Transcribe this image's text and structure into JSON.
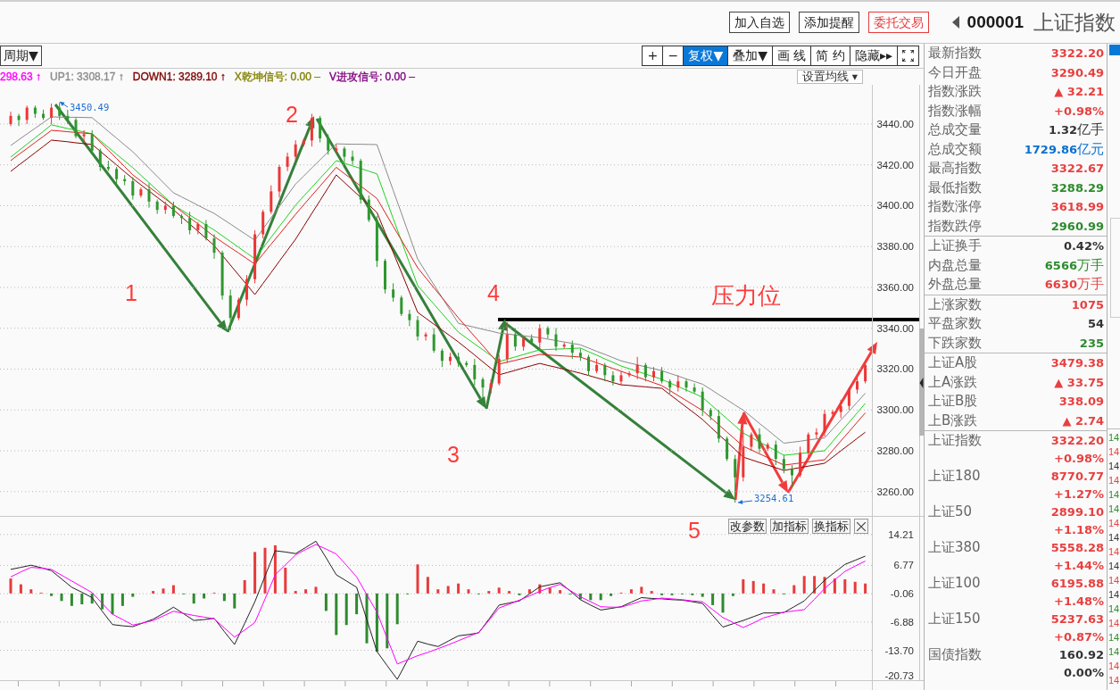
{
  "top_bar": {
    "buttons": [
      {
        "label": "加入自选",
        "kind": "plain"
      },
      {
        "label": "添加提醒",
        "kind": "plain"
      },
      {
        "label": "委托交易",
        "kind": "trade"
      }
    ],
    "code": "000001",
    "name": "上证指数"
  },
  "chart_toolbar": {
    "period_button": "周期▼",
    "buttons": [
      {
        "label": "+",
        "kind": "text",
        "selected": false
      },
      {
        "label": "−",
        "kind": "text",
        "selected": false
      },
      {
        "label": "复权▼",
        "kind": "text",
        "selected": true
      },
      {
        "label": "叠加▼",
        "kind": "text",
        "selected": false
      },
      {
        "label": "画 线",
        "kind": "text",
        "selected": false
      },
      {
        "label": "简 约",
        "kind": "text",
        "selected": false
      },
      {
        "label": "隐藏▸▸",
        "kind": "text",
        "selected": false
      },
      {
        "kind": "fullscreen",
        "selected": false
      }
    ]
  },
  "legend": [
    {
      "text": "298.63 ↑",
      "color": "#ff00ff"
    },
    {
      "text": "UP1: 3308.17 ↑",
      "color": "#8c8c8c"
    },
    {
      "text": "DOWN1: 3289.10 ↑",
      "color": "#800000"
    },
    {
      "text": "X乾坤信号: 0.00 –",
      "color": "#808000"
    },
    {
      "text": "V进攻信号: 0.00 –",
      "color": "#800080"
    }
  ],
  "ma_dropdown": "设置均线 ▾",
  "price_chart": {
    "high_label": "3450.49",
    "low_label": "3254.61",
    "chart_data": {
      "type": "candlestick",
      "grid": true,
      "ylim": [
        3248.1,
        3459.2
      ],
      "yticks": [
        {
          "value": 3440,
          "label": "3440.00"
        },
        {
          "value": 3420,
          "label": "3420.00"
        },
        {
          "value": 3400,
          "label": "3400.00"
        },
        {
          "value": 3380,
          "label": "3380.00"
        },
        {
          "value": 3360,
          "label": "3360.00"
        },
        {
          "value": 3340,
          "label": "3340.00"
        },
        {
          "value": 3320,
          "label": "3320.00"
        },
        {
          "value": 3300,
          "label": "3300.00"
        },
        {
          "value": 3280,
          "label": "3280.00"
        },
        {
          "value": 3260,
          "label": "3260.00"
        }
      ],
      "ohlc": [
        [
          3440,
          3446,
          3439,
          3444
        ],
        [
          3444,
          3445,
          3439,
          3442
        ],
        [
          3442,
          3449,
          3440,
          3448
        ],
        [
          3448,
          3449,
          3443,
          3445
        ],
        [
          3445,
          3447,
          3442,
          3443
        ],
        [
          3443,
          3450,
          3440,
          3448
        ],
        [
          3448,
          3450.5,
          3442,
          3444
        ],
        [
          3444,
          3447,
          3440,
          3442
        ],
        [
          3442,
          3443,
          3433,
          3434
        ],
        [
          3434,
          3437,
          3431,
          3435
        ],
        [
          3435,
          3437,
          3425,
          3427
        ],
        [
          3427,
          3428,
          3417,
          3419
        ],
        [
          3419,
          3422,
          3417,
          3418
        ],
        [
          3418,
          3419,
          3410,
          3413
        ],
        [
          3413,
          3415,
          3410,
          3412
        ],
        [
          3412,
          3414,
          3403,
          3405
        ],
        [
          3405,
          3409,
          3404,
          3408
        ],
        [
          3408,
          3411,
          3399,
          3402
        ],
        [
          3402,
          3403,
          3396,
          3398
        ],
        [
          3398,
          3402,
          3396,
          3400
        ],
        [
          3400,
          3402,
          3394,
          3395
        ],
        [
          3395,
          3396,
          3391,
          3394
        ],
        [
          3394,
          3397,
          3386,
          3388
        ],
        [
          3388,
          3392,
          3386,
          3391
        ],
        [
          3391,
          3393,
          3383,
          3384
        ],
        [
          3384,
          3386,
          3374,
          3377
        ],
        [
          3377,
          3378,
          3354,
          3356
        ],
        [
          3356,
          3359,
          3339,
          3345
        ],
        [
          3345,
          3355,
          3344,
          3354
        ],
        [
          3354,
          3366,
          3351,
          3364
        ],
        [
          3364,
          3388,
          3362,
          3386
        ],
        [
          3386,
          3398,
          3384,
          3397
        ],
        [
          3397,
          3410,
          3396,
          3407
        ],
        [
          3407,
          3420,
          3404,
          3419
        ],
        [
          3419,
          3426,
          3417,
          3424
        ],
        [
          3424,
          3432,
          3422,
          3430
        ],
        [
          3430,
          3433,
          3429,
          3432
        ],
        [
          3432,
          3445,
          3429,
          3443
        ],
        [
          3443,
          3444,
          3431,
          3433
        ],
        [
          3433,
          3435,
          3425,
          3427
        ],
        [
          3427,
          3430,
          3426,
          3428
        ],
        [
          3428,
          3429,
          3421,
          3424
        ],
        [
          3424,
          3427,
          3420,
          3422
        ],
        [
          3422,
          3423,
          3401,
          3403
        ],
        [
          3403,
          3405,
          3392,
          3393
        ],
        [
          3393,
          3395,
          3370,
          3373
        ],
        [
          3373,
          3374,
          3357,
          3359
        ],
        [
          3359,
          3362,
          3353,
          3355
        ],
        [
          3355,
          3356,
          3346,
          3347
        ],
        [
          3347,
          3349,
          3341,
          3344
        ],
        [
          3344,
          3346,
          3334,
          3336
        ],
        [
          3336,
          3338,
          3334,
          3337
        ],
        [
          3337,
          3340,
          3328,
          3329
        ],
        [
          3329,
          3330,
          3321,
          3324
        ],
        [
          3324,
          3328,
          3322,
          3326
        ],
        [
          3326,
          3328,
          3321,
          3323
        ],
        [
          3323,
          3324,
          3321,
          3322
        ],
        [
          3322,
          3325,
          3312,
          3315
        ],
        [
          3315,
          3316,
          3302,
          3311
        ],
        [
          3311,
          3315,
          3308,
          3313
        ],
        [
          3313,
          3327,
          3312,
          3325
        ],
        [
          3325,
          3343,
          3323,
          3337
        ],
        [
          3337,
          3340,
          3329,
          3331
        ],
        [
          3331,
          3336,
          3329,
          3335
        ],
        [
          3335,
          3337,
          3332,
          3333
        ],
        [
          3333,
          3342,
          3330,
          3340
        ],
        [
          3340,
          3341,
          3335,
          3337
        ],
        [
          3337,
          3340,
          3329,
          3331
        ],
        [
          3331,
          3333,
          3330,
          3332
        ],
        [
          3332,
          3334,
          3325,
          3328
        ],
        [
          3328,
          3330,
          3324,
          3326
        ],
        [
          3326,
          3327,
          3317,
          3319
        ],
        [
          3319,
          3325,
          3318,
          3322
        ],
        [
          3322,
          3323,
          3314,
          3317
        ],
        [
          3317,
          3319,
          3312,
          3314
        ],
        [
          3314,
          3319,
          3312,
          3317
        ],
        [
          3317,
          3319,
          3316,
          3318
        ],
        [
          3318,
          3326,
          3315,
          3322
        ],
        [
          3322,
          3323,
          3314,
          3316
        ],
        [
          3316,
          3321,
          3314,
          3319
        ],
        [
          3319,
          3321,
          3313,
          3314
        ],
        [
          3314,
          3315,
          3308,
          3311
        ],
        [
          3311,
          3317,
          3309,
          3314
        ],
        [
          3314,
          3315,
          3309,
          3311
        ],
        [
          3311,
          3313,
          3308,
          3309
        ],
        [
          3309,
          3311,
          3297,
          3300
        ],
        [
          3300,
          3301,
          3295,
          3297
        ],
        [
          3297,
          3300,
          3284,
          3286
        ],
        [
          3286,
          3287,
          3275,
          3276
        ],
        [
          3276,
          3278,
          3254.6,
          3267
        ],
        [
          3267,
          3290,
          3265,
          3282
        ],
        [
          3282,
          3289,
          3280,
          3288
        ],
        [
          3288,
          3291,
          3279,
          3281
        ],
        [
          3281,
          3284,
          3280,
          3283
        ],
        [
          3283,
          3285,
          3273,
          3276
        ],
        [
          3276,
          3278,
          3269,
          3271
        ],
        [
          3271,
          3273,
          3262,
          3268
        ],
        [
          3268,
          3282,
          3267,
          3279
        ],
        [
          3279,
          3289,
          3276,
          3288
        ],
        [
          3288,
          3291,
          3286,
          3289
        ],
        [
          3289,
          3300,
          3287,
          3298
        ],
        [
          3298,
          3300,
          3297,
          3299
        ],
        [
          3299,
          3305,
          3296,
          3302
        ],
        [
          3302,
          3311,
          3300,
          3310
        ],
        [
          3310,
          3316,
          3308,
          3314
        ],
        [
          3314,
          3323,
          3313,
          3322
        ]
      ],
      "series": [
        {
          "type": "line",
          "color": "#8a8a8a",
          "values": [
            3429.5,
            3432.3,
            3435.1,
            3437.9,
            3440.7,
            3443.5,
            3443.4,
            3443.3,
            3443.3,
            3443.2,
            3443.1,
            3439.8,
            3436.4,
            3433.1,
            3429.7,
            3426.4,
            3422.4,
            3418.4,
            3414.3,
            3410.3,
            3406.3,
            3404.3,
            3402.3,
            3400.2,
            3398.2,
            3396.2,
            3393.6,
            3391.0,
            3388.3,
            3385.7,
            3383.1,
            3388.6,
            3394.1,
            3399.6,
            3405.1,
            3410.6,
            3414.5,
            3418.5,
            3422.4,
            3426.4,
            3430.3,
            3430.2,
            3430.1,
            3430.1,
            3430.0,
            3429.9,
            3418.7,
            3407.5,
            3396.3,
            3385.1,
            3373.9,
            3367.6,
            3361.3,
            3355.0,
            3348.7,
            3342.4,
            3341.4,
            3340.5,
            3339.5,
            3338.6,
            3337.6,
            3337.2,
            3336.7,
            3336.3,
            3335.8,
            3335.4,
            3334.7,
            3334.0,
            3333.3,
            3332.6,
            3331.9,
            3330.3,
            3328.7,
            3327.2,
            3325.6,
            3324.0,
            3323.0,
            3322.1,
            3321.1,
            3320.2,
            3319.2,
            3317.9,
            3316.6,
            3315.2,
            3313.9,
            3312.6,
            3310.1,
            3307.5,
            3305.0,
            3302.4,
            3299.9,
            3296.7,
            3293.4,
            3290.2,
            3286.9,
            3283.7,
            3284.2,
            3284.7,
            3285.3,
            3285.8,
            3286.3,
            3290.7,
            3295.1,
            3299.4,
            3303.8,
            3308.2
          ]
        },
        {
          "type": "line",
          "color": "#1ed21e",
          "values": [
            3423.8,
            3427.0,
            3430.1,
            3433.3,
            3436.4,
            3439.6,
            3438.7,
            3437.8,
            3437.0,
            3436.1,
            3435.2,
            3431.9,
            3428.6,
            3425.2,
            3421.9,
            3418.6,
            3414.9,
            3411.3,
            3407.6,
            3404.0,
            3400.3,
            3397.9,
            3395.4,
            3393.0,
            3390.5,
            3388.1,
            3385.3,
            3382.5,
            3379.6,
            3376.8,
            3374.0,
            3379.3,
            3384.5,
            3389.8,
            3395.0,
            3400.3,
            3404.7,
            3409.0,
            3413.4,
            3417.7,
            3422.1,
            3420.8,
            3419.5,
            3418.2,
            3416.9,
            3415.6,
            3404.7,
            3393.7,
            3382.8,
            3371.8,
            3360.9,
            3356.3,
            3351.8,
            3347.2,
            3342.7,
            3338.1,
            3335.2,
            3332.3,
            3329.5,
            3326.6,
            3323.7,
            3324.8,
            3326.0,
            3327.1,
            3328.3,
            3329.4,
            3329.6,
            3329.8,
            3329.9,
            3330.1,
            3330.3,
            3328.5,
            3326.8,
            3325.0,
            3323.3,
            3321.5,
            3320.2,
            3318.9,
            3317.6,
            3316.3,
            3315.0,
            3313.2,
            3311.5,
            3309.7,
            3308.0,
            3306.2,
            3302.7,
            3299.2,
            3295.7,
            3292.2,
            3288.7,
            3286.5,
            3284.3,
            3282.2,
            3280.0,
            3277.8,
            3278.2,
            3278.7,
            3279.1,
            3279.6,
            3280.0,
            3284.6,
            3289.3,
            3293.9,
            3298.6,
            3303.2
          ]
        },
        {
          "type": "line",
          "color": "#e02020",
          "values": [
            3422.1,
            3425.1,
            3428.0,
            3431.0,
            3433.9,
            3436.9,
            3436.6,
            3436.2,
            3435.9,
            3435.5,
            3435.2,
            3431.2,
            3427.2,
            3423.1,
            3419.1,
            3415.1,
            3412.1,
            3409.2,
            3406.2,
            3403.3,
            3400.3,
            3397.2,
            3394.1,
            3391.1,
            3388.0,
            3384.9,
            3382.2,
            3379.5,
            3376.8,
            3374.1,
            3371.4,
            3376.3,
            3381.2,
            3386.0,
            3390.9,
            3395.8,
            3400.4,
            3405.0,
            3409.6,
            3414.2,
            3418.8,
            3415.7,
            3412.7,
            3409.6,
            3406.6,
            3403.5,
            3396.7,
            3389.9,
            3383.2,
            3376.4,
            3369.6,
            3364.7,
            3359.8,
            3354.9,
            3350.0,
            3345.1,
            3340.6,
            3336.0,
            3331.5,
            3326.9,
            3322.4,
            3323.4,
            3324.3,
            3325.3,
            3326.2,
            3327.2,
            3326.9,
            3326.7,
            3326.4,
            3326.2,
            3325.9,
            3324.5,
            3323.1,
            3321.7,
            3320.3,
            3318.9,
            3317.5,
            3316.1,
            3314.7,
            3313.3,
            3311.9,
            3309.5,
            3307.0,
            3304.6,
            3302.1,
            3299.7,
            3296.2,
            3292.7,
            3289.2,
            3285.7,
            3282.2,
            3280.4,
            3278.5,
            3276.7,
            3274.8,
            3273.0,
            3273.5,
            3274.0,
            3274.6,
            3275.1,
            3275.6,
            3280.2,
            3284.8,
            3289.4,
            3294.0,
            3298.6
          ]
        },
        {
          "type": "line",
          "color": "#8b0000",
          "values": [
            3416.8,
            3419.9,
            3422.9,
            3426.0,
            3429.0,
            3432.1,
            3431.7,
            3431.3,
            3430.8,
            3430.4,
            3430.0,
            3426.7,
            3423.3,
            3420.0,
            3416.6,
            3413.3,
            3410.2,
            3407.2,
            3404.1,
            3401.1,
            3398.0,
            3394.5,
            3391.0,
            3387.5,
            3384.0,
            3380.5,
            3375.7,
            3370.9,
            3366.1,
            3361.3,
            3356.5,
            3361.9,
            3367.3,
            3372.8,
            3378.2,
            3383.6,
            3389.9,
            3396.2,
            3402.5,
            3408.8,
            3415.1,
            3411.4,
            3407.7,
            3404.1,
            3400.4,
            3396.7,
            3386.9,
            3377.1,
            3367.4,
            3357.6,
            3347.8,
            3344.9,
            3342.0,
            3339.1,
            3336.2,
            3333.3,
            3330.1,
            3326.9,
            3323.6,
            3320.4,
            3317.2,
            3318.3,
            3319.4,
            3320.6,
            3321.7,
            3322.8,
            3321.8,
            3320.9,
            3319.9,
            3319.0,
            3318.0,
            3316.9,
            3315.7,
            3314.6,
            3313.4,
            3312.3,
            3312.0,
            3311.6,
            3311.3,
            3310.9,
            3310.6,
            3307.5,
            3304.5,
            3301.4,
            3298.4,
            3295.3,
            3291.6,
            3287.9,
            3284.3,
            3280.6,
            3276.9,
            3275.6,
            3274.3,
            3273.0,
            3271.7,
            3270.4,
            3271.1,
            3271.8,
            3272.5,
            3273.2,
            3273.9,
            3276.9,
            3280.0,
            3283.0,
            3286.1,
            3289.1
          ]
        }
      ]
    }
  },
  "annotations": {
    "wave_numbers": [
      "1",
      "2",
      "3",
      "4",
      "5"
    ],
    "resistance_label": "压力位"
  },
  "macd_panel": {
    "buttons": [
      "改参数",
      "加指标",
      "换指标"
    ],
    "chart_data": {
      "type": "line",
      "grid": true,
      "ylim": [
        -20.9,
        18.47
      ],
      "yticks": [
        {
          "value": 14.21,
          "label": "14.21"
        },
        {
          "value": 6.77,
          "label": "6.77"
        },
        {
          "value": -0.06,
          "label": "-0.06"
        },
        {
          "value": -6.88,
          "label": "-6.88"
        },
        {
          "value": -13.7,
          "label": "-13.70"
        },
        {
          "value": -20.73,
          "label": "-20.73"
        }
      ],
      "series": [
        {
          "type": "bar",
          "color": "#e83b3b",
          "values": [
            3.6,
            2.2,
            1.0,
            0.2,
            null,
            null,
            null,
            null,
            null,
            null,
            null,
            null,
            null,
            null,
            0.6,
            1.2,
            2.0,
            null,
            null,
            null,
            0.2,
            null,
            null,
            3.2,
            10.0,
            11.0,
            11.6,
            6.2,
            0.6,
            1.0,
            1.6,
            null,
            null,
            null,
            null,
            null,
            null,
            null,
            null,
            null,
            7.0,
            4.0,
            1.0,
            1.8,
            2.4,
            1.0,
            null,
            0.6,
            1.4,
            0.6,
            null,
            1.0,
            2.2,
            1.4,
            0.8,
            null,
            null,
            null,
            null,
            null,
            0.2,
            1.0,
            1.6,
            0.6,
            null,
            null,
            null,
            null,
            null,
            null,
            null,
            null,
            3.4,
            3.0,
            2.4,
            1.0,
            null,
            2.0,
            4.2,
            4.2,
            4.0,
            3.6,
            3.4,
            2.8,
            2.4
          ]
        },
        {
          "type": "bar",
          "color": "#2f8a2f",
          "values": [
            null,
            null,
            null,
            null,
            -0.6,
            -1.8,
            -3.0,
            -2.6,
            -2.4,
            -3.8,
            -5.0,
            -3.0,
            -0.8,
            null,
            null,
            null,
            null,
            -0.2,
            -2.4,
            -1.2,
            null,
            -1.8,
            -3.6,
            null,
            null,
            null,
            null,
            null,
            null,
            null,
            null,
            -4.2,
            -10.0,
            -7.6,
            -5.0,
            -12.0,
            -14.0,
            -13.2,
            -7.4,
            -0.2,
            null,
            null,
            null,
            null,
            null,
            null,
            -0.2,
            null,
            null,
            null,
            -0.4,
            null,
            null,
            null,
            null,
            -0.2,
            -1.4,
            -1.6,
            -1.6,
            -0.6,
            null,
            null,
            null,
            null,
            -0.4,
            -0.4,
            -0.2,
            -0.4,
            -0.8,
            -2.8,
            -4.6,
            -0.6,
            null,
            null,
            null,
            null,
            -0.2,
            null,
            null,
            null,
            null,
            null,
            null,
            null,
            null
          ]
        },
        {
          "type": "line",
          "color": "#222222",
          "values": [
            5.8,
            6.3,
            6.8,
            6.2,
            5.5,
            3.5,
            1.5,
            0.3,
            -1.0,
            -4.3,
            -7.5,
            -7.8,
            -8.0,
            -7.1,
            -6.2,
            -4.8,
            -3.3,
            -4.9,
            -6.5,
            -6.3,
            -6.0,
            -9.2,
            -12.3,
            -7.2,
            -2.0,
            4.2,
            10.3,
            10.0,
            9.6,
            11.1,
            12.6,
            8.6,
            4.5,
            3.0,
            1.5,
            -6.3,
            -14.0,
            -17.4,
            -20.7,
            -16.1,
            -11.5,
            -12.2,
            -12.8,
            -11.5,
            -10.2,
            -9.9,
            -9.5,
            -6.2,
            -2.8,
            -2.3,
            -1.8,
            -0.1,
            1.6,
            2.1,
            2.6,
            0.6,
            -1.5,
            -2.8,
            -4.0,
            -3.6,
            -3.2,
            -2.1,
            -1.0,
            -1.2,
            -1.3,
            -1.5,
            -1.6,
            -2.0,
            -2.4,
            -5.3,
            -8.1,
            -7.3,
            -6.5,
            -5.6,
            -4.7,
            -4.7,
            -4.6,
            -3.2,
            -1.8,
            0.7,
            3.2,
            5.1,
            7.0,
            8.0,
            9.0
          ]
        },
        {
          "type": "line",
          "color": "#ff00ff",
          "values": [
            4.0,
            5.2,
            6.3,
            6.1,
            5.8,
            4.4,
            3.0,
            1.6,
            0.2,
            -2.4,
            -5.0,
            -6.3,
            -7.6,
            -7.1,
            -6.5,
            -5.4,
            -4.3,
            -4.8,
            -5.3,
            -5.7,
            -6.1,
            -8.3,
            -10.5,
            -8.8,
            -7.0,
            -1.3,
            4.5,
            6.9,
            9.3,
            10.6,
            11.8,
            10.7,
            9.5,
            6.8,
            4.0,
            -0.3,
            -4.5,
            -10.8,
            -17.0,
            -16.0,
            -15.0,
            -14.2,
            -13.3,
            -12.4,
            -11.4,
            -10.4,
            -9.4,
            -6.5,
            -3.5,
            -2.6,
            -1.6,
            -0.6,
            0.5,
            1.4,
            2.2,
            0.7,
            -0.8,
            -2.0,
            -3.2,
            -3.3,
            -3.3,
            -2.6,
            -1.8,
            -1.5,
            -1.1,
            -1.3,
            -1.5,
            -1.8,
            -2.0,
            -3.9,
            -5.8,
            -7.0,
            -8.2,
            -7.1,
            -5.9,
            -5.2,
            -4.5,
            -4.2,
            -3.9,
            -1.4,
            1.2,
            3.3,
            5.3,
            6.6,
            7.8
          ]
        }
      ]
    }
  },
  "quote_panel": {
    "sections": [
      [
        {
          "label": "最新指数",
          "value": "3322.20",
          "kind": "number",
          "color": "#e84040"
        },
        {
          "label": "今日开盘",
          "value": "3290.49",
          "kind": "number",
          "color": "#e84040"
        },
        {
          "label": "指数涨跌",
          "value": "▲ 32.21",
          "kind": "number",
          "color": "#e84040"
        },
        {
          "label": "指数涨幅",
          "value": "+0.98%",
          "kind": "number",
          "color": "#e84040"
        },
        {
          "label": "总成交量",
          "value": "**1.32**亿手",
          "kind": "amount",
          "color": "#333333"
        },
        {
          "label": "总成交额",
          "value": "**1729.86**亿元",
          "kind": "amount",
          "color": "#0a6fd0"
        },
        {
          "label": "最高指数",
          "value": "3322.67",
          "kind": "number",
          "color": "#e84040"
        },
        {
          "label": "最低指数",
          "value": "3288.29",
          "kind": "number",
          "color": "#2e8b2e"
        },
        {
          "label": "指数涨停",
          "value": "3618.99",
          "kind": "number",
          "color": "#e84040"
        },
        {
          "label": "指数跌停",
          "value": "2960.99",
          "kind": "number",
          "color": "#2e8b2e"
        }
      ],
      [
        {
          "label": "上证换手",
          "value": "0.42%",
          "kind": "number",
          "color": "#333333"
        },
        {
          "label": "内盘总量",
          "value": "**6566**万手",
          "kind": "amount",
          "color": "#2e8b2e"
        },
        {
          "label": "外盘总量",
          "value": "**6630**万手",
          "kind": "amount",
          "color": "#e84040"
        }
      ],
      [
        {
          "label": "上涨家数",
          "value": "1075",
          "kind": "number",
          "color": "#e84040"
        },
        {
          "label": "平盘家数",
          "value": "54",
          "kind": "number",
          "color": "#333333"
        },
        {
          "label": "下跌家数",
          "value": "235",
          "kind": "number",
          "color": "#2e8b2e"
        }
      ],
      [
        {
          "label": "上证A股",
          "value": "3479.38",
          "kind": "number",
          "color": "#e84040"
        },
        {
          "label": "上A涨跌",
          "value": "▲ 33.75",
          "kind": "number",
          "color": "#e84040"
        },
        {
          "label": "上证B股",
          "value": "338.09",
          "kind": "number",
          "color": "#e84040"
        },
        {
          "label": "上B涨跌",
          "value": "▲ 2.74",
          "kind": "number",
          "color": "#e84040"
        }
      ]
    ]
  },
  "index_list": [
    {
      "name": "上证指数",
      "value": "3322.20",
      "change": "+0.98%",
      "color": "#e84040"
    },
    {
      "name": "上证180",
      "value": "8770.77",
      "change": "+1.27%",
      "color": "#e84040"
    },
    {
      "name": "上证50",
      "value": "2899.10",
      "change": "+1.18%",
      "color": "#e84040"
    },
    {
      "name": "上证380",
      "value": "5558.28",
      "change": "+1.44%",
      "color": "#e84040"
    },
    {
      "name": "上证100",
      "value": "6195.88",
      "change": "+1.48%",
      "color": "#e84040"
    },
    {
      "name": "上证150",
      "value": "5237.63",
      "change": "+0.87%",
      "color": "#e84040"
    },
    {
      "name": "国债指数",
      "value": "160.92",
      "change": "0.00%",
      "color": "#333333"
    }
  ],
  "tick_strip": {
    "times": [
      {
        "text": "14",
        "color": "#2e8b2e"
      },
      {
        "text": "14",
        "color": "#e84040"
      },
      {
        "text": "14",
        "color": "#333333"
      },
      {
        "text": "14",
        "color": "#e84040"
      },
      {
        "text": "14",
        "color": "#2e8b2e"
      },
      {
        "text": "14",
        "color": "#2e8b2e"
      },
      {
        "text": "14",
        "color": "#e84040"
      },
      {
        "text": "14",
        "color": "#333333"
      },
      {
        "text": "14",
        "color": "#e84040"
      },
      {
        "text": "14",
        "color": "#333333"
      },
      {
        "text": "14",
        "color": "#e84040"
      },
      {
        "text": "14",
        "color": "#333333"
      },
      {
        "text": "14",
        "color": "#2e8b2e"
      },
      {
        "text": "14",
        "color": "#e84040"
      },
      {
        "text": "14",
        "color": "#2e8b2e"
      },
      {
        "text": "14",
        "color": "#2e8b2e"
      },
      {
        "text": "14",
        "color": "#e84040"
      },
      {
        "text": "14",
        "color": "#e84040"
      }
    ]
  }
}
